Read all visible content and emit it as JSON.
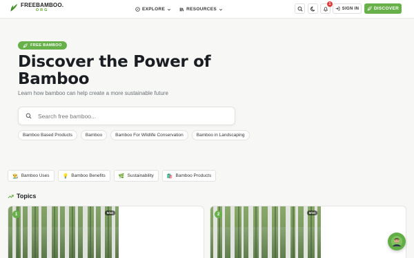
{
  "brand": {
    "title": "FREEBAMBOO.",
    "subtitle": "ORG"
  },
  "nav": {
    "explore": "EXPLORE",
    "resources": "RESOURCES"
  },
  "header": {
    "notification_count": "1",
    "signin": "SIGN IN",
    "discover": "DISCOVER"
  },
  "hero": {
    "badge": "FREE BAMBOO",
    "title": "Discover the Power of Bamboo",
    "subtitle": "Learn how bamboo can help create a more sustainable future",
    "search_placeholder": "Search free bamboo...",
    "chips": [
      "Bamboo Based Products",
      "Bamboo",
      "Bamboo For Wildlife Conservation",
      "Bamboo in Landscaping"
    ]
  },
  "categories": [
    {
      "icon": "👨‍🌾",
      "label": "Bamboo Uses"
    },
    {
      "icon": "💡",
      "label": "Bamboo Benefits"
    },
    {
      "icon": "🌿",
      "label": "Sustainability"
    },
    {
      "icon": "🛍️",
      "label": "Bamboo Products"
    }
  ],
  "topics": {
    "heading": "Topics",
    "cards": [
      {
        "number": "1",
        "rating": "9/10"
      },
      {
        "number": "2",
        "rating": "8/10"
      }
    ]
  },
  "colors": {
    "accent": "#67b04a",
    "badge_red": "#e03b3b"
  }
}
